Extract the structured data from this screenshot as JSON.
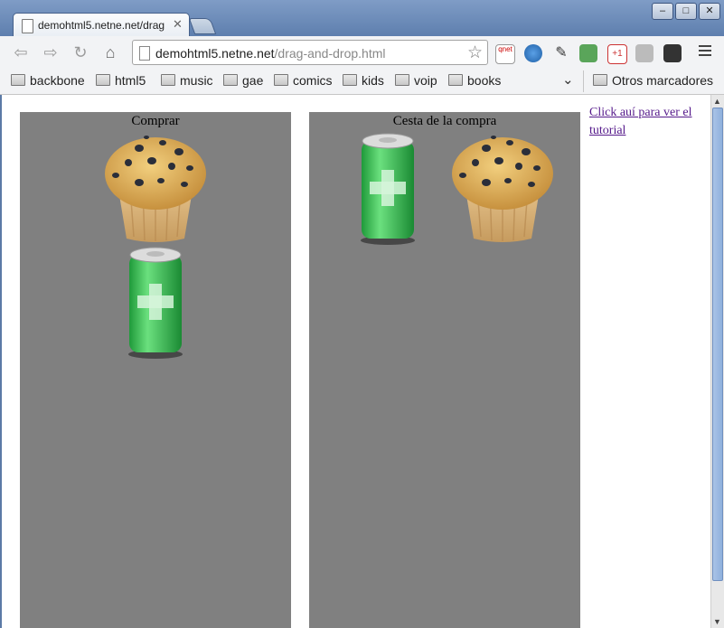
{
  "window": {
    "tab_title": "demohtml5.netne.net/drag",
    "controls": {
      "minimize": "–",
      "maximize": "□",
      "close": "✕"
    }
  },
  "toolbar": {
    "url_host": "demohtml5.netne.net",
    "url_path": "/drag-and-drop.html",
    "back_icon": "back-arrow-icon",
    "forward_icon": "forward-arrow-icon",
    "reload_icon": "reload-icon",
    "home_icon": "home-icon",
    "ext_qnet_label": "qnet"
  },
  "bookmarks": {
    "items": [
      {
        "label": "backbone"
      },
      {
        "label": "html5"
      },
      {
        "label": "music"
      },
      {
        "label": "gae"
      },
      {
        "label": "comics"
      },
      {
        "label": "kids"
      },
      {
        "label": "voip"
      },
      {
        "label": "books"
      }
    ],
    "other": "Otros marcadores"
  },
  "page": {
    "left_panel_title": "Comprar",
    "right_panel_title": "Cesta de la compra",
    "tutorial_link": "Click auí para ver el tutorial",
    "panel_color": "#808080",
    "link_color": "#551a8b"
  }
}
